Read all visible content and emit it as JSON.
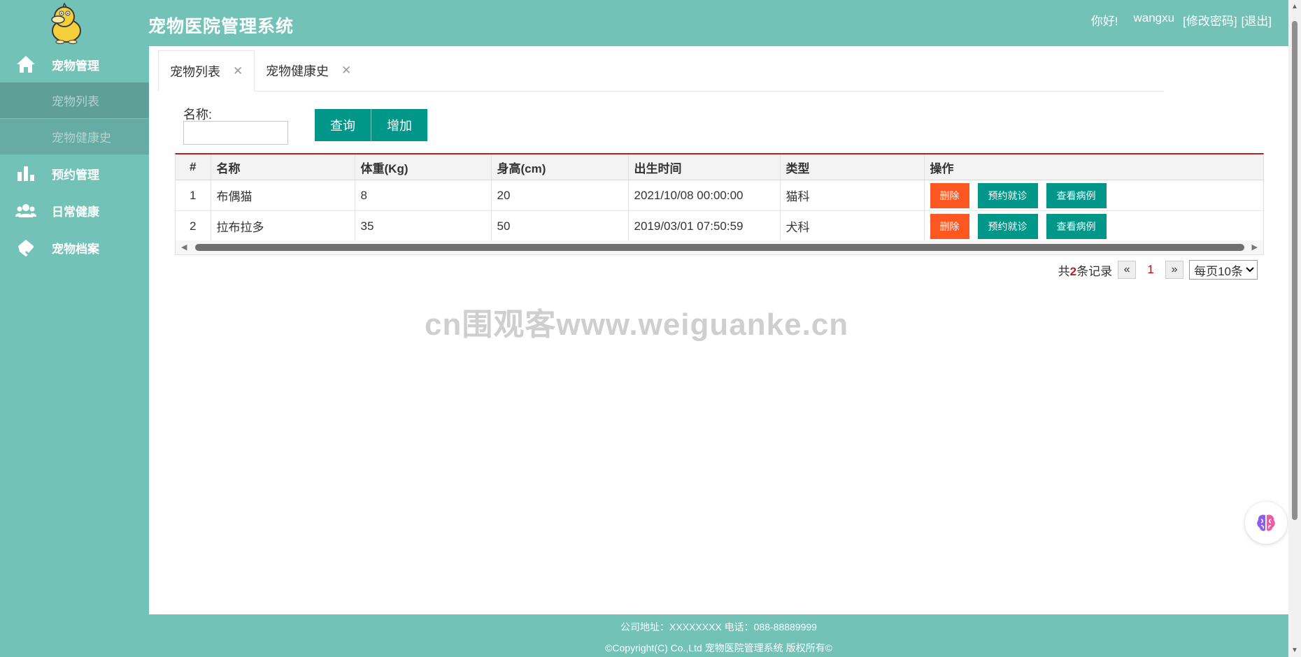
{
  "app": {
    "title": "宠物医院管理系统",
    "greeting": "你好!",
    "username": "wangxu",
    "change_password": "[修改密码]",
    "logout": "[退出]"
  },
  "sidebar": {
    "items": [
      {
        "label": "宠物管理",
        "icon": "home-icon"
      },
      {
        "label": "宠物列表",
        "sub": true
      },
      {
        "label": "宠物健康史",
        "sub": true
      },
      {
        "label": "预约管理",
        "icon": "bar-chart-icon"
      },
      {
        "label": "日常健康",
        "icon": "users-icon"
      },
      {
        "label": "宠物档案",
        "icon": "pet-record-icon"
      }
    ]
  },
  "tabs": [
    {
      "label": "宠物列表",
      "close": "✕"
    },
    {
      "label": "宠物健康史",
      "close": "✕"
    }
  ],
  "search": {
    "label": "名称:",
    "value": "",
    "query_button": "查询",
    "add_button": "增加"
  },
  "table": {
    "headers": [
      "#",
      "名称",
      "体重(Kg)",
      "身高(cm)",
      "出生时间",
      "类型",
      "操作"
    ],
    "rows": [
      {
        "index": "1",
        "name": "布偶猫",
        "weight": "8",
        "height": "20",
        "birth": "2021/10/08 00:00:00",
        "type": "猫科"
      },
      {
        "index": "2",
        "name": "拉布拉多",
        "weight": "35",
        "height": "50",
        "birth": "2019/03/01 07:50:59",
        "type": "犬科"
      }
    ],
    "actions": {
      "delete": "删除",
      "appointment": "预约就诊",
      "view_cases": "查看病例"
    }
  },
  "pager": {
    "total_prefix": "共",
    "total_count": "2",
    "total_suffix": "条记录",
    "prev": "«",
    "current": "1",
    "next": "»",
    "page_size": "每页10条"
  },
  "watermark": "cn围观客www.weiguanke.cn",
  "footer": {
    "line1": "公司地址：XXXXXXXX 电话：088-88889999",
    "line2": "©Copyright(C) Co.,Ltd 宠物医院管理系统 版权所有©"
  },
  "colors": {
    "header": "#72c2b8",
    "primary": "#009688",
    "danger": "#ff5722",
    "table_top_border": "#b22222"
  }
}
